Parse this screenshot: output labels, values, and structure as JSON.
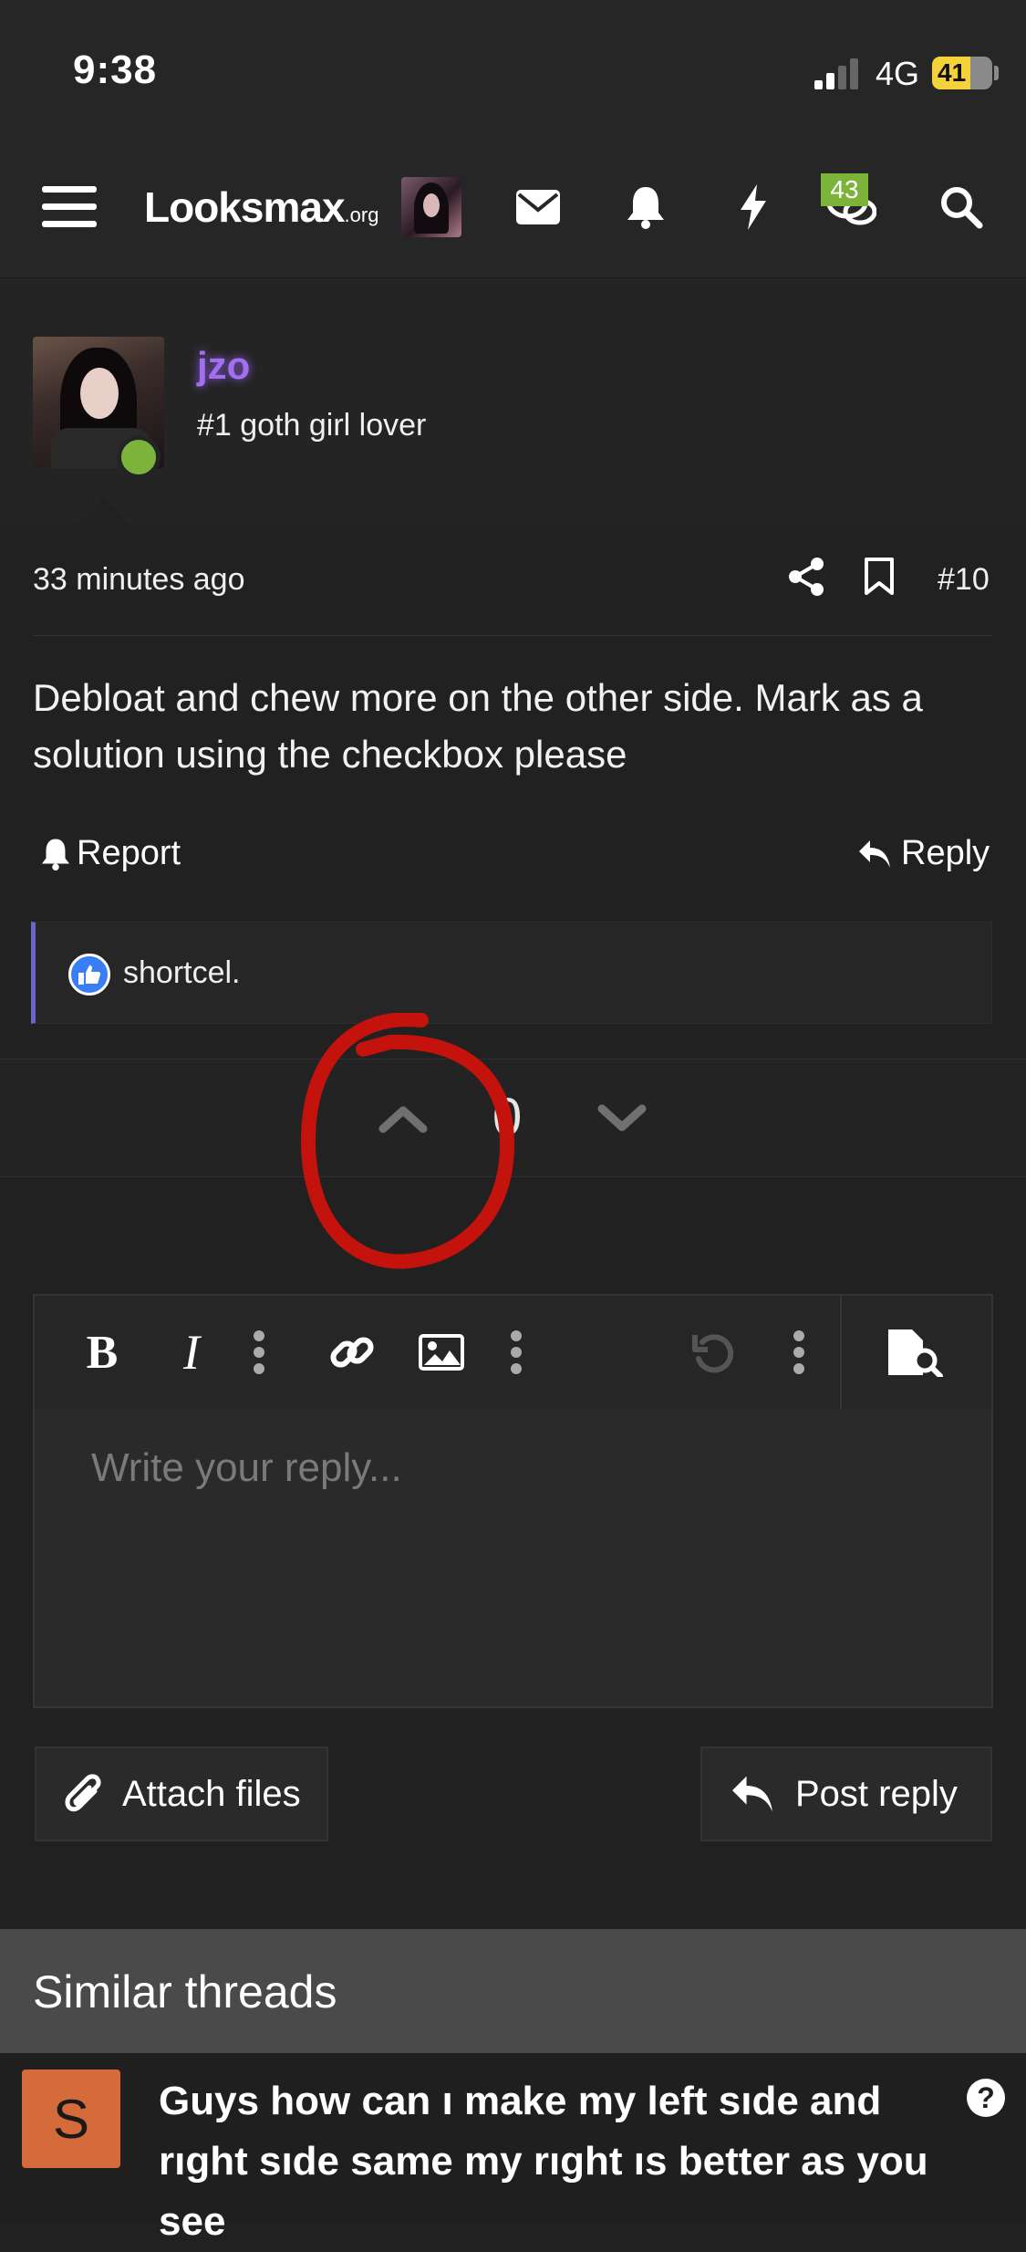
{
  "status_bar": {
    "time": "9:38",
    "network": "4G",
    "battery": "41"
  },
  "nav": {
    "logo": "Looksmax",
    "logo_suffix": ".org",
    "conversations_badge": "43",
    "icons": [
      "menu-icon",
      "envelope-icon",
      "bell-icon",
      "bolt-icon",
      "chat-icon",
      "search-icon"
    ]
  },
  "post": {
    "username": "jzo",
    "user_title": "#1 goth girl lover",
    "time": "33 minutes ago",
    "number": "#10",
    "body": "Debloat and chew more on the other side. Mark as a solution using the checkbox please",
    "report_label": "Report",
    "reply_label": "Reply",
    "reaction_user": "shortcel.",
    "vote_score": "0"
  },
  "editor": {
    "placeholder": "Write your reply...",
    "attach_label": "Attach files",
    "post_reply_label": "Post reply"
  },
  "similar": {
    "title": "Similar threads",
    "threads": [
      {
        "avatar_letter": "S",
        "title": "Guys how can ı make my left sıde and rıght sıde same my rıght ıs better as you see"
      }
    ]
  },
  "colors": {
    "background": "#212121",
    "username": "#a26ff0",
    "online": "#7bb33b",
    "badge": "#7bb33b",
    "reaction_border": "#6767c9",
    "annotation": "#c4120c"
  }
}
